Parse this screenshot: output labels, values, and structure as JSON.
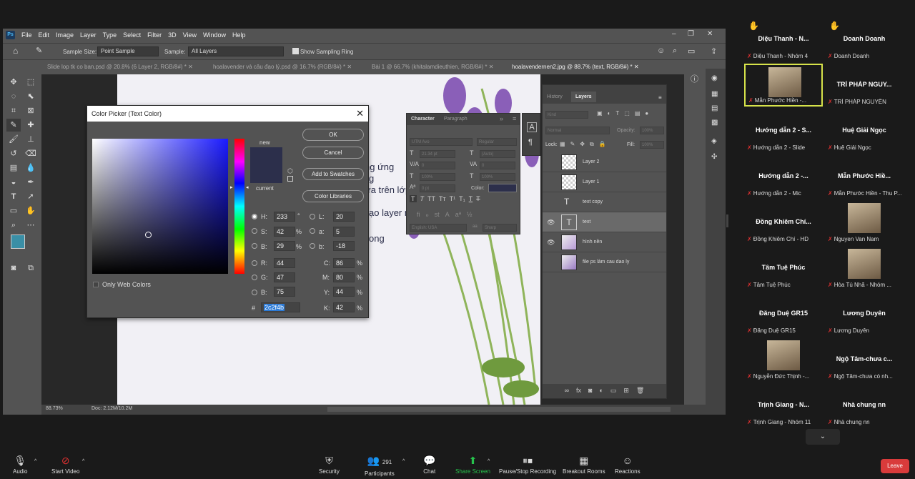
{
  "photoshop": {
    "menu": [
      "File",
      "Edit",
      "Image",
      "Layer",
      "Type",
      "Select",
      "Filter",
      "3D",
      "View",
      "Window",
      "Help"
    ],
    "logo": "Ps",
    "options": {
      "sample_size_label": "Sample Size:",
      "sample_size_value": "Point Sample",
      "sample_label": "Sample:",
      "sample_value": "All Layers",
      "show_ring_label": "Show Sampling Ring"
    },
    "tabs": [
      "Slide lop tk co ban.psd @ 20.8% (6 Layer 2, RGB/8#) *",
      "hoalavender và câu đạo lý.psd @ 16.7% (RGB/8#) *",
      "Bài 1 @ 66.7% (khitalamdieuthien, RGB/8#) *",
      "hoalavendernen2.jpg @ 88.7% (text, RGB/8#) *"
    ],
    "canvas_texts": [
      "ng ứng",
      "g",
      "ửa trên lớp",
      "ạo layer mới",
      "ong"
    ],
    "status": {
      "zoom": "88.73%",
      "doc": "Doc: 2.12M/10.2M"
    },
    "character_panel": {
      "tabs": [
        "Character",
        "Paragraph"
      ],
      "font": "UTM Avo",
      "style": "Regular",
      "size": "21.34 pt",
      "leading": "(Auto)",
      "tracking": "0",
      "kerning": "0",
      "scale": "100%",
      "baseline": "0 pt",
      "color_label": "Color:",
      "language": "English: USA",
      "aa": "Sharp"
    },
    "layers_panel": {
      "tabs": [
        "History",
        "Layers"
      ],
      "kind": "Kind",
      "blend": "Normal",
      "opacity_label": "Opacity:",
      "opacity": "100%",
      "lock_label": "Lock:",
      "fill_label": "Fill:",
      "fill": "100%",
      "layers": [
        {
          "name": "Layer 2",
          "type": "raster",
          "visible": false,
          "selected": false
        },
        {
          "name": "Layer 1",
          "type": "raster",
          "visible": false,
          "selected": false
        },
        {
          "name": "text copy",
          "type": "text",
          "visible": false,
          "selected": false
        },
        {
          "name": "text",
          "type": "text",
          "visible": true,
          "selected": true
        },
        {
          "name": "hình nền",
          "type": "image",
          "visible": true,
          "selected": false
        },
        {
          "name": "file ps làm cau dao ly",
          "type": "image",
          "visible": false,
          "selected": false
        }
      ]
    },
    "color_picker": {
      "title": "Color Picker (Text Color)",
      "new_label": "new",
      "current_label": "current",
      "ok": "OK",
      "cancel": "Cancel",
      "add_swatches": "Add to Swatches",
      "color_libraries": "Color Libraries",
      "only_web": "Only Web Colors",
      "H": "233",
      "S": "42",
      "B": "29",
      "R": "44",
      "G": "47",
      "Bv": "75",
      "L": "20",
      "a": "5",
      "b": "-18",
      "C": "86",
      "M": "80",
      "Y": "44",
      "K": "42",
      "hex": "2c2f4b",
      "h_unit": "°",
      "pct": "%",
      "color": "#2c2f4b"
    }
  },
  "zoom": {
    "participants": [
      {
        "name": "Diệu Thanh - N...",
        "sub": "Diệu Thanh - Nhóm 4",
        "hand": true
      },
      {
        "name": "Doanh Doanh",
        "sub": "Doanh Doanh",
        "hand": true
      },
      {
        "name": "",
        "sub": "Mẫn Phước Hiền -...",
        "video": true,
        "highlight": true
      },
      {
        "name": "TRÍ PHÁP NGUY...",
        "sub": "TRÍ PHÁP NGUYÊN"
      },
      {
        "name": "Hướng dẫn 2 - S...",
        "sub": "Hướng dẫn 2 - Slide"
      },
      {
        "name": "Huệ Giải Ngọc",
        "sub": "Huệ Giải Ngọc"
      },
      {
        "name": "Hướng dẫn 2 -...",
        "sub": "Hướng dẫn 2 - Mic"
      },
      {
        "name": "Mẫn Phước Hiề...",
        "sub": "Mẫn Phước Hiền - Thu P..."
      },
      {
        "name": "Đồng Khiêm Chí...",
        "sub": "Đồng Khiêm Chí - HD"
      },
      {
        "name": "",
        "sub": "Nguyen Van Nam",
        "video": true
      },
      {
        "name": "Tâm Tuệ Phúc",
        "sub": "Tâm Tuệ Phúc"
      },
      {
        "name": "",
        "sub": "Hòa Tú Nhã - Nhóm ...",
        "video": true
      },
      {
        "name": "Đăng Duệ GR15",
        "sub": "Đăng Duệ GR15"
      },
      {
        "name": "Lương Duyên",
        "sub": "Lương Duyên"
      },
      {
        "name": "",
        "sub": "Nguyễn Đức Thịnh -...",
        "video": true
      },
      {
        "name": "Ngộ Tâm-chưa c...",
        "sub": "Ngộ Tâm-chưa có nh..."
      },
      {
        "name": "Trịnh Giang - N...",
        "sub": "Trịnh Giang - Nhóm 11"
      },
      {
        "name": "Nhà chung nn",
        "sub": "Nhà chung nn"
      }
    ],
    "toolbar": {
      "audio": "Audio",
      "start_video": "Start Video",
      "security": "Security",
      "participants": "Participants",
      "participant_count": "291",
      "chat": "Chat",
      "share_screen": "Share Screen",
      "recording": "Pause/Stop Recording",
      "breakout": "Breakout Rooms",
      "reactions": "Reactions",
      "leave": "Leave"
    }
  }
}
